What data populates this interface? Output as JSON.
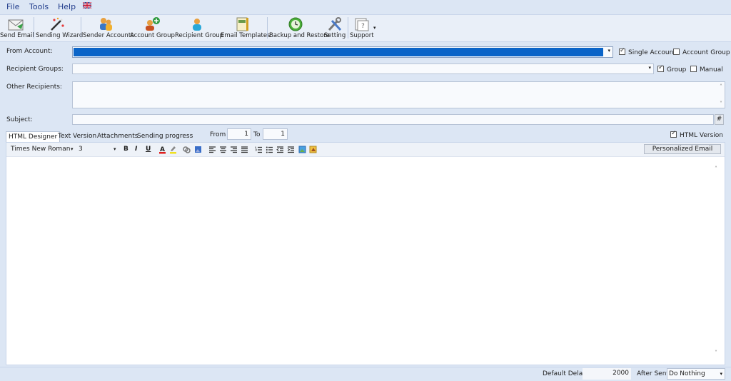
{
  "menu": {
    "file": "File",
    "tools": "Tools",
    "help": "Help"
  },
  "toolbar": {
    "send_email": "Send Email",
    "sending_wizard": "Sending Wizard",
    "sender_accounts": "Sender Accounts",
    "account_group": "Account Group",
    "recipient_group": "Recipient Group",
    "email_templates": "Email Templates",
    "backup_restore": "Backup and Restore",
    "setting": "Setting",
    "support": "Support"
  },
  "form": {
    "from_account_label": "From Account:",
    "single_account_label": "Single Account",
    "account_group_label": "Account Group",
    "recipient_groups_label": "Recipient Groups:",
    "group_label": "Group",
    "manual_label": "Manual",
    "other_recipients_label": "Other Recipients:",
    "subject_label": "Subject:",
    "subject_hash": "#"
  },
  "tabs": {
    "html_designer": "HTML Designer",
    "text_version": "Text Version",
    "attachments": "Attachments",
    "sending_progress": "Sending progress",
    "from_label": "From",
    "from_value": "1",
    "to_label": "To",
    "to_value": "1",
    "html_version_label": "HTML Version"
  },
  "format": {
    "font_name": "Times New Roman",
    "font_size": "3",
    "bold": "B",
    "italic": "I",
    "underline": "U",
    "personalized_email": "Personalized Email"
  },
  "status": {
    "default_delay_label": "Default Delay",
    "default_delay_value": "2000",
    "after_sent_label": "After Sent",
    "after_sent_value": "Do Nothing"
  },
  "colors": {
    "accent": "#0a64c8",
    "menu_text": "#1e3a8a"
  }
}
